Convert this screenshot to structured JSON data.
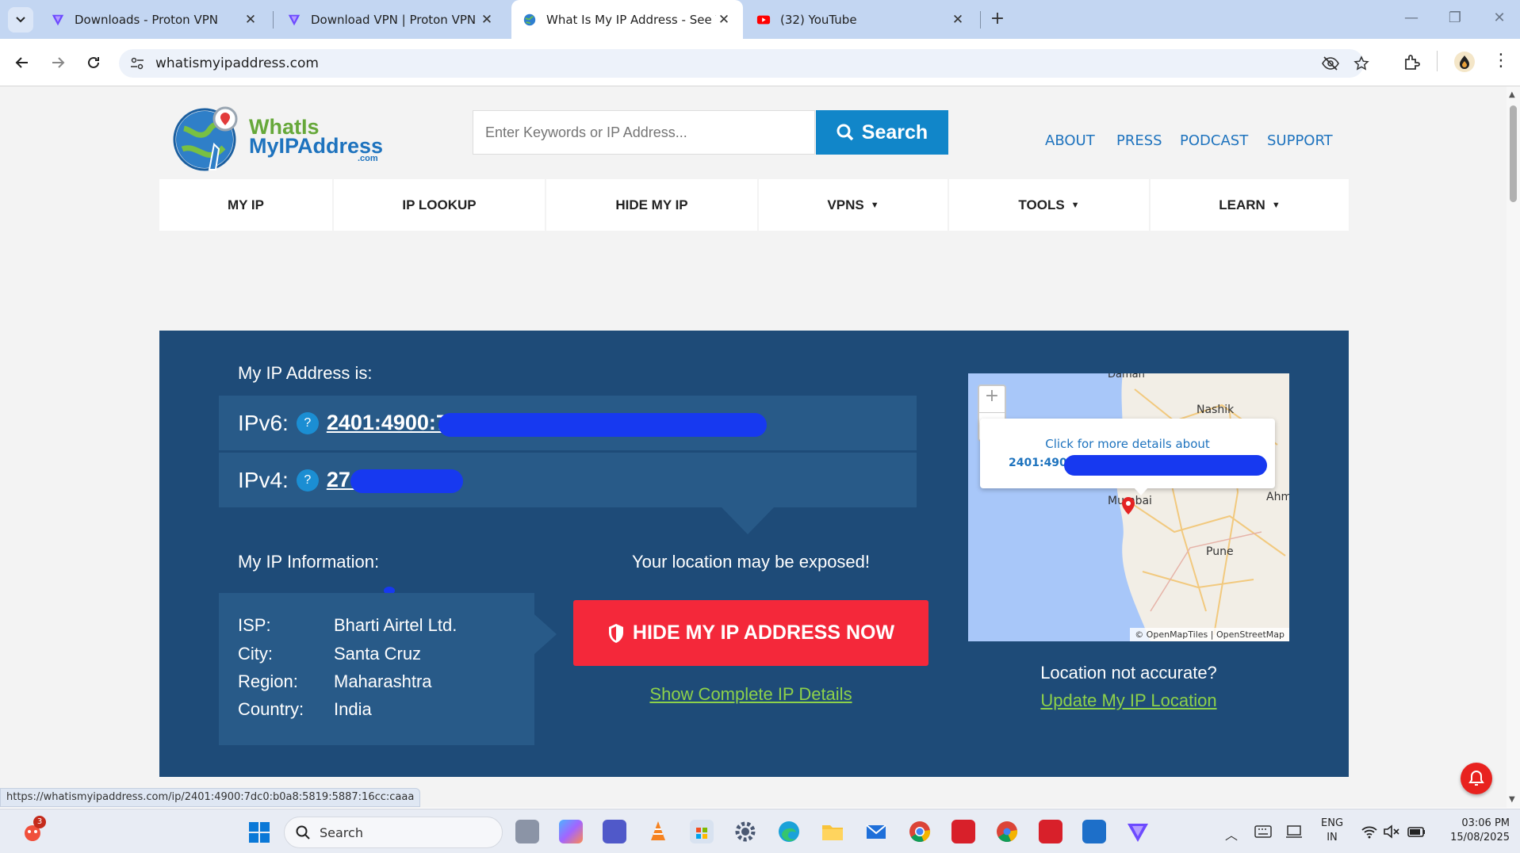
{
  "browser": {
    "tabs": [
      {
        "title": "Downloads - Proton VPN"
      },
      {
        "title": "Download VPN | Proton VPN"
      },
      {
        "title": "What Is My IP Address - See Yo"
      },
      {
        "title": "(32) YouTube"
      }
    ],
    "url": "whatismyipaddress.com",
    "status_url": "https://whatismyipaddress.com/ip/2401:4900:7dc0:b0a8:5819:5887:16cc:caaa",
    "colors": {
      "tabstrip": "#c3d6f2",
      "omnibox": "#edf2fa"
    }
  },
  "site": {
    "logo": {
      "line1": "WhatIs",
      "line2": "MyIPAddress",
      "suffix": ".com"
    },
    "search": {
      "placeholder": "Enter Keywords or IP Address...",
      "button": "Search"
    },
    "toplinks": [
      "ABOUT",
      "PRESS",
      "PODCAST",
      "SUPPORT"
    ],
    "nav": [
      "MY IP",
      "IP LOOKUP",
      "HIDE MY IP",
      "VPNS",
      "TOOLS",
      "LEARN"
    ],
    "dropdown_arrow": "▼",
    "panel": {
      "heading": "My IP Address is:",
      "ipv6_label": "IPv6:",
      "ipv6_value": "2401:4900:7dc0:b0a8:5819:5887:16",
      "ipv4_label": "IPv4:",
      "ipv4_value": "27.",
      "info_heading": "My IP Information:",
      "info": [
        {
          "label": "ISP:",
          "value": "Bharti Airtel Ltd."
        },
        {
          "label": "City:",
          "value": "Santa Cruz"
        },
        {
          "label": "Region:",
          "value": "Maharashtra"
        },
        {
          "label": "Country:",
          "value": "India"
        }
      ],
      "exposed_text": "Your location may be exposed!",
      "hide_button": "HIDE MY IP ADDRESS NOW",
      "details_link": "Show Complete IP Details",
      "map": {
        "popup_text": "Click for more details about",
        "popup_ip": "2401:490",
        "cities": [
          "Daman",
          "Nashik",
          "Mumbai",
          "Pune",
          "Ahm"
        ],
        "attribution": "© OpenMapTiles | OpenStreetMap",
        "zoom_in": "+",
        "zoom_out": "−"
      },
      "not_accurate": "Location not accurate?",
      "update_link": "Update My IP Location"
    },
    "colors": {
      "panel": "#1e4b78",
      "accent_blue": "#1e73be",
      "hide_red": "#f4283a",
      "link_green": "#8dd14a"
    }
  },
  "taskbar": {
    "search": "Search",
    "lang1": "ENG",
    "lang2": "IN",
    "time": "03:06 PM",
    "date": "15/08/2025",
    "notification_count": "3"
  }
}
